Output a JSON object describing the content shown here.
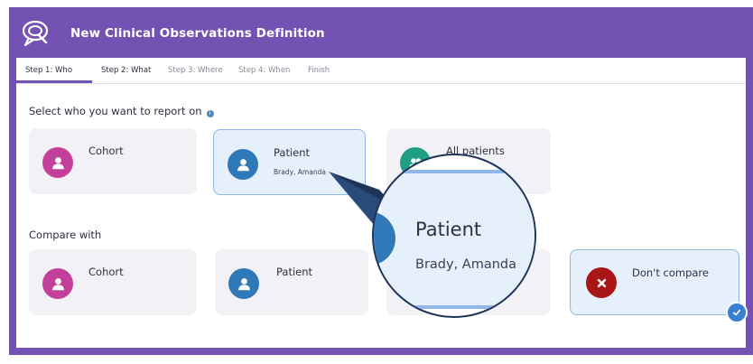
{
  "window": {
    "title": "New Clinical Observations Definition",
    "logo_icon": "speech-bubble-logo-icon"
  },
  "tabs": [
    {
      "label": "Step 1: Who",
      "state": "active"
    },
    {
      "label": "Step 2: What",
      "state": "done"
    },
    {
      "label": "Step 3: Where",
      "state": "pending"
    },
    {
      "label": "Step 4: When",
      "state": "pending"
    },
    {
      "label": "Finish",
      "state": "pending"
    }
  ],
  "report_on": {
    "label": "Select who you want to report on",
    "info_icon": "info-icon",
    "options": [
      {
        "title": "Cohort",
        "subtitle": "",
        "icon": "person-icon",
        "color": "#c2409a",
        "selected": false
      },
      {
        "title": "Patient",
        "subtitle": "Brady, Amanda",
        "icon": "person-icon",
        "color": "#3079b8",
        "selected": true
      },
      {
        "title": "All patients",
        "subtitle": "",
        "icon": "group-icon",
        "color": "#1f9e85",
        "selected": false
      }
    ]
  },
  "compare_with": {
    "label": "Compare with",
    "options": [
      {
        "title": "Cohort",
        "subtitle": "",
        "icon": "person-icon",
        "color": "#c2409a",
        "selected": false
      },
      {
        "title": "Patient",
        "subtitle": "",
        "icon": "person-icon",
        "color": "#3079b8",
        "selected": false
      },
      {
        "title": "",
        "subtitle": "",
        "icon": "group-icon",
        "color": "#1f9e85",
        "selected": false
      },
      {
        "title": "Don't compare",
        "subtitle": "",
        "icon": "close-icon",
        "color": "#a81616",
        "selected": true
      }
    ]
  },
  "zoom": {
    "title": "Patient",
    "subtitle": "Brady, Amanda"
  },
  "colors": {
    "brand": "#7452b3",
    "selected_border": "#8fb8e8",
    "check": "#3a7fd0"
  }
}
